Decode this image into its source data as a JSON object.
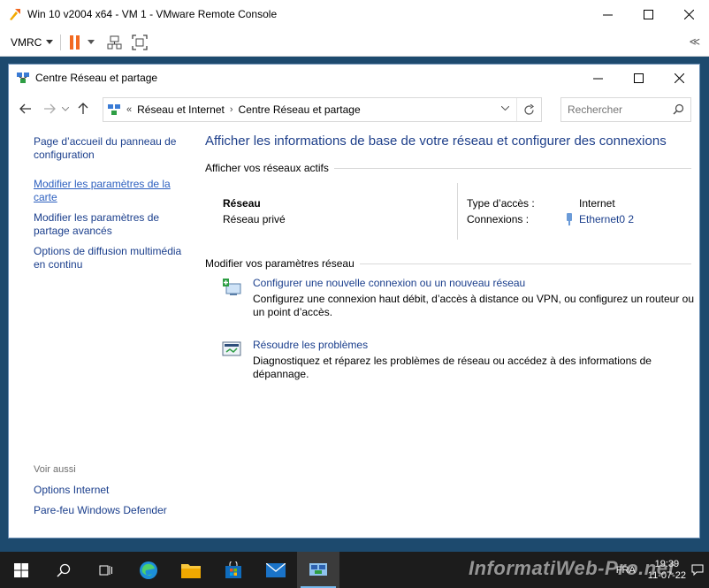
{
  "vmrc": {
    "window_title": "Win 10 v2004 x64 - VM 1 - VMware Remote Console",
    "menu_label": "VMRC",
    "collapse_glyph": "≪"
  },
  "cp_window": {
    "title": "Centre Réseau et partage",
    "breadcrumb": [
      "Réseau et Internet",
      "Centre Réseau et partage"
    ],
    "breadcrumb_overflow": "«",
    "search_placeholder": "Rechercher"
  },
  "left_pane": {
    "links": [
      "Page d’accueil du panneau de configuration",
      "Modifier les paramètres de la carte",
      "Modifier les paramètres de partage avancés",
      "Options de diffusion multimédia en continu"
    ],
    "see_also_label": "Voir aussi",
    "see_also_links": [
      "Options Internet",
      "Pare-feu Windows Defender"
    ]
  },
  "main": {
    "title": "Afficher les informations de base de votre réseau et configurer des connexions",
    "active_networks_header": "Afficher vos réseaux actifs",
    "network_name": "Réseau",
    "network_type": "Réseau privé",
    "access_type_label": "Type d’accès :",
    "access_type_value": "Internet",
    "connections_label": "Connexions :",
    "connections_value": "Ethernet0 2",
    "change_settings_header": "Modifier vos paramètres réseau",
    "tasks": [
      {
        "link": "Configurer une nouvelle connexion ou un nouveau réseau",
        "desc": "Configurez une connexion haut débit, d’accès à distance ou VPN, ou configurez un routeur ou un point d’accès."
      },
      {
        "link": "Résoudre les problèmes",
        "desc": "Diagnostiquez et réparez les problèmes de réseau ou accédez à des informations de dépannage."
      }
    ]
  },
  "taskbar": {
    "lang": "FRA",
    "time": "19:39",
    "date": "11-07-22",
    "watermark": "InformatiWeb-Pro.net"
  },
  "colors": {
    "link": "#1a3e8c",
    "title_blue": "#1e3f8a",
    "accent_orange": "#f26a21",
    "taskbar_bg": "#1c1c1c"
  }
}
